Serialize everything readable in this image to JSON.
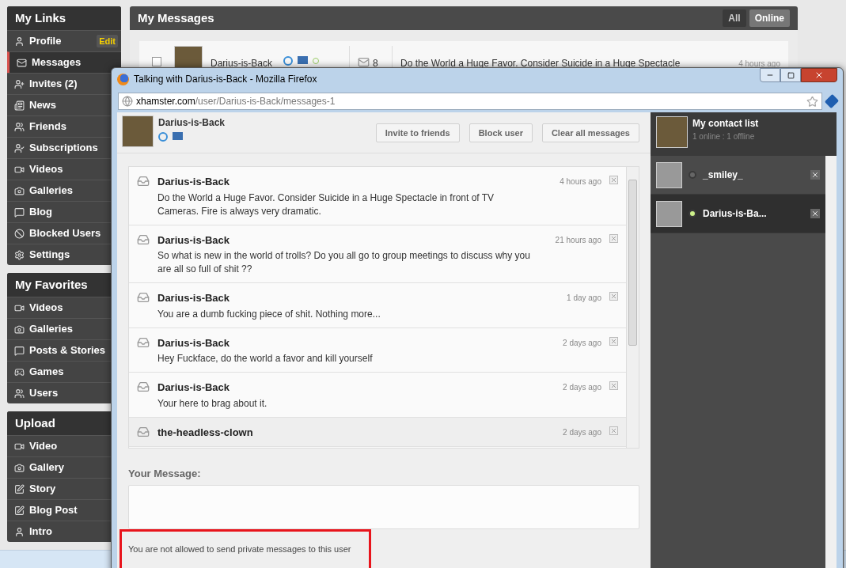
{
  "sidebar": {
    "sections": [
      {
        "title": "My Links",
        "items": [
          {
            "label": "Profile",
            "badge": "Edit",
            "selected": false
          },
          {
            "label": "Messages",
            "selected": true
          },
          {
            "label": "Invites (2)",
            "selected": false
          },
          {
            "label": "News",
            "selected": false
          },
          {
            "label": "Friends",
            "selected": false
          },
          {
            "label": "Subscriptions",
            "selected": false
          },
          {
            "label": "Videos",
            "selected": false
          },
          {
            "label": "Galleries",
            "selected": false
          },
          {
            "label": "Blog",
            "selected": false
          },
          {
            "label": "Blocked Users",
            "selected": false
          },
          {
            "label": "Settings",
            "selected": false
          }
        ]
      },
      {
        "title": "My Favorites",
        "items": [
          {
            "label": "Videos",
            "selected": false
          },
          {
            "label": "Galleries",
            "selected": false
          },
          {
            "label": "Posts & Stories",
            "selected": false
          },
          {
            "label": "Games",
            "selected": false
          },
          {
            "label": "Users",
            "selected": false
          }
        ]
      },
      {
        "title": "Upload",
        "items": [
          {
            "label": "Video",
            "selected": false
          },
          {
            "label": "Gallery",
            "selected": false
          },
          {
            "label": "Story",
            "selected": false
          },
          {
            "label": "Blog Post",
            "selected": false
          },
          {
            "label": "Intro",
            "selected": false
          }
        ]
      }
    ]
  },
  "messages_panel": {
    "title": "My Messages",
    "filters": [
      {
        "label": "All",
        "selected": false
      },
      {
        "label": "Online",
        "selected": true
      }
    ],
    "rows": [
      {
        "checked": false,
        "sender": "Darius-is-Back",
        "count": "8",
        "subject": "Do the World a Huge Favor. Consider Suicide in a Huge Spectacle",
        "time": "4 hours ago"
      }
    ]
  },
  "popup": {
    "title": "Talking with Darius-is-Back - Mozilla Firefox",
    "url_host": "xhamster.com",
    "url_path": "/user/Darius-is-Back/messages-1",
    "chat": {
      "name": "Darius-is-Back",
      "buttons": [
        "Invite to friends",
        "Block user",
        "Clear all messages"
      ],
      "messages": [
        {
          "sender": "Darius-is-Back",
          "time": "4 hours ago",
          "body": "Do the World a Huge Favor. Consider Suicide in a Huge Spectacle in front of TV Cameras. Fire is always very dramatic.",
          "unread": false
        },
        {
          "sender": "Darius-is-Back",
          "time": "21 hours ago",
          "body": "So what is new in the world of trolls? Do you all go to group meetings to discuss why you are all so full of shit ??",
          "unread": false
        },
        {
          "sender": "Darius-is-Back",
          "time": "1 day ago",
          "body": "You are a dumb fucking piece of shit. Nothing more...",
          "unread": false
        },
        {
          "sender": "Darius-is-Back",
          "time": "2 days ago",
          "body": "Hey Fuckface, do the world a favor and kill yourself",
          "unread": false
        },
        {
          "sender": "Darius-is-Back",
          "time": "2 days ago",
          "body": "Your here to brag about it.",
          "unread": false
        },
        {
          "sender": "the-headless-clown",
          "time": "2 days ago",
          "unread": true
        }
      ],
      "compose_label": "Your Message:",
      "notice": "You are not allowed to send private messages to this user"
    },
    "contacts": {
      "title": "My contact list",
      "status": "1 online : 1 offline",
      "items": [
        {
          "name": "_smiley_",
          "online": false,
          "selected": false
        },
        {
          "name": "Darius-is-Ba...",
          "online": true,
          "selected": true
        }
      ]
    }
  }
}
